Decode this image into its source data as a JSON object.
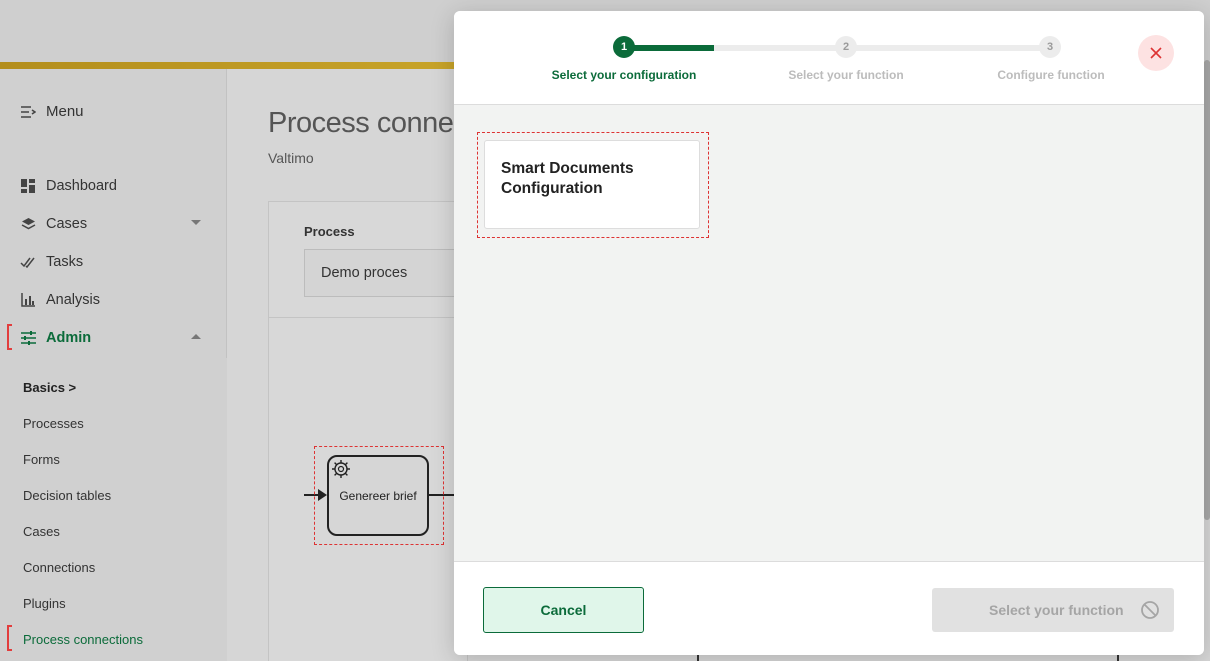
{
  "sidebar": {
    "menu_label": "Menu",
    "nav": [
      {
        "label": "Dashboard"
      },
      {
        "label": "Cases"
      },
      {
        "label": "Tasks"
      },
      {
        "label": "Analysis"
      },
      {
        "label": "Admin"
      }
    ],
    "admin_sub": [
      {
        "label": "Basics >"
      },
      {
        "label": "Processes"
      },
      {
        "label": "Forms"
      },
      {
        "label": "Decision tables"
      },
      {
        "label": "Cases"
      },
      {
        "label": "Connections"
      },
      {
        "label": "Plugins"
      },
      {
        "label": "Process connections"
      }
    ]
  },
  "main": {
    "title": "Process connect",
    "subtitle": "Valtimo",
    "process_label": "Process",
    "process_value": "Demo proces",
    "task_label": "Genereer brief"
  },
  "modal": {
    "steps": [
      {
        "number": "1",
        "label": "Select your configuration",
        "state": "current"
      },
      {
        "number": "2",
        "label": "Select your function",
        "state": "todo"
      },
      {
        "number": "3",
        "label": "Configure function",
        "state": "todo"
      }
    ],
    "close_icon": "close-icon",
    "configuration_card": "Smart Documents Configuration",
    "cancel_label": "Cancel",
    "next_label": "Select your function",
    "colors": {
      "accent": "#0b6b3a",
      "danger": "#dd3333",
      "disabled": "#e1e1e1"
    }
  }
}
